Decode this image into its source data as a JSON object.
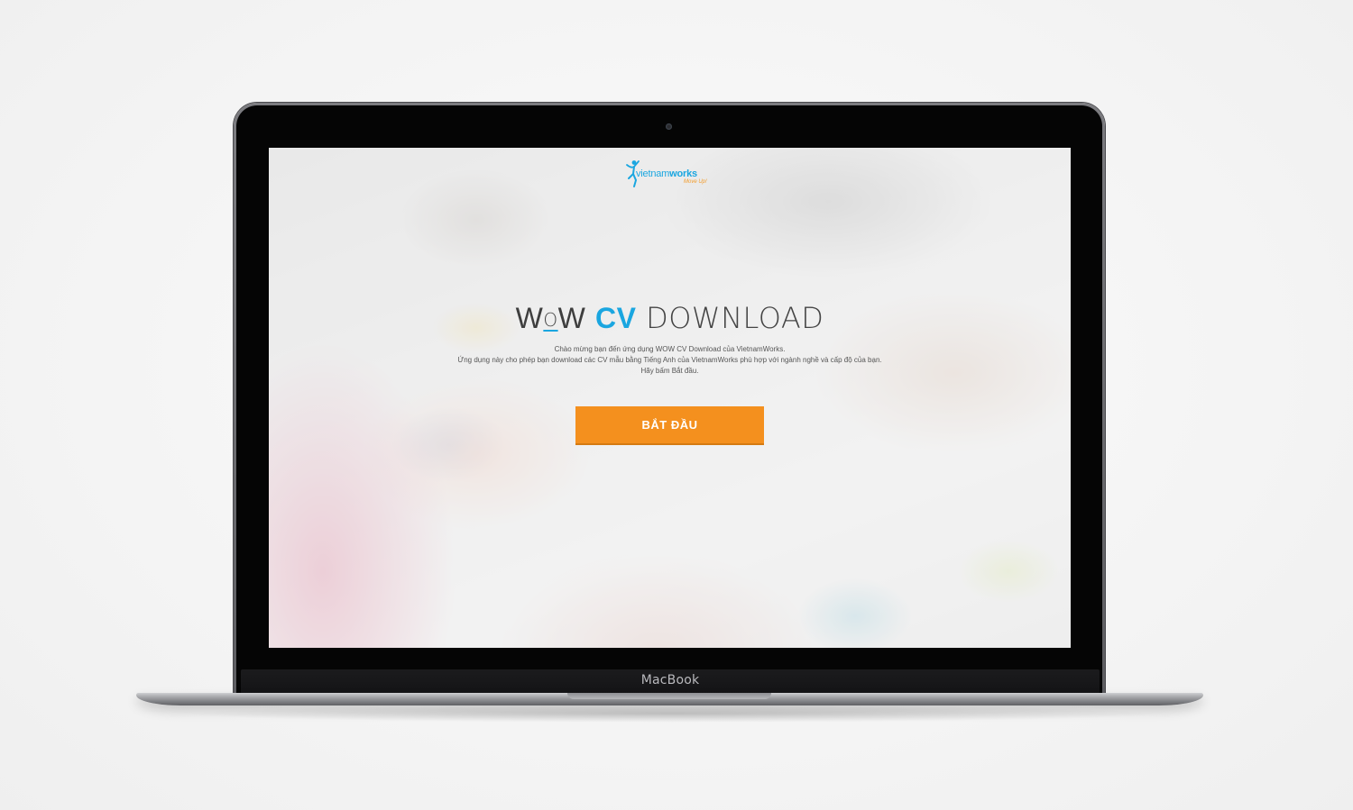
{
  "device": {
    "brand_label": "MacBook"
  },
  "page": {
    "logo": {
      "word_light": "vietnam",
      "word_bold": "works",
      "tagline": "Move Up!"
    },
    "title": {
      "w1": "W",
      "o": "O",
      "w2": "W",
      "highlight": "CV",
      "rest": "DOWNLOAD"
    },
    "description": [
      "Chào mừng bạn đến ứng dụng WOW CV Download của VietnamWorks.",
      "Ứng dụng này cho phép bạn download các CV mẫu bằng Tiếng Anh của VietnamWorks phù hợp với ngành nghề và cấp độ của bạn.",
      "Hãy bấm Bắt đầu."
    ],
    "cta_label": "BẮT ĐẦU"
  },
  "colors": {
    "accent_blue": "#1aa6e0",
    "cta_orange": "#f4901e",
    "tagline_orange": "#f39c2b"
  }
}
